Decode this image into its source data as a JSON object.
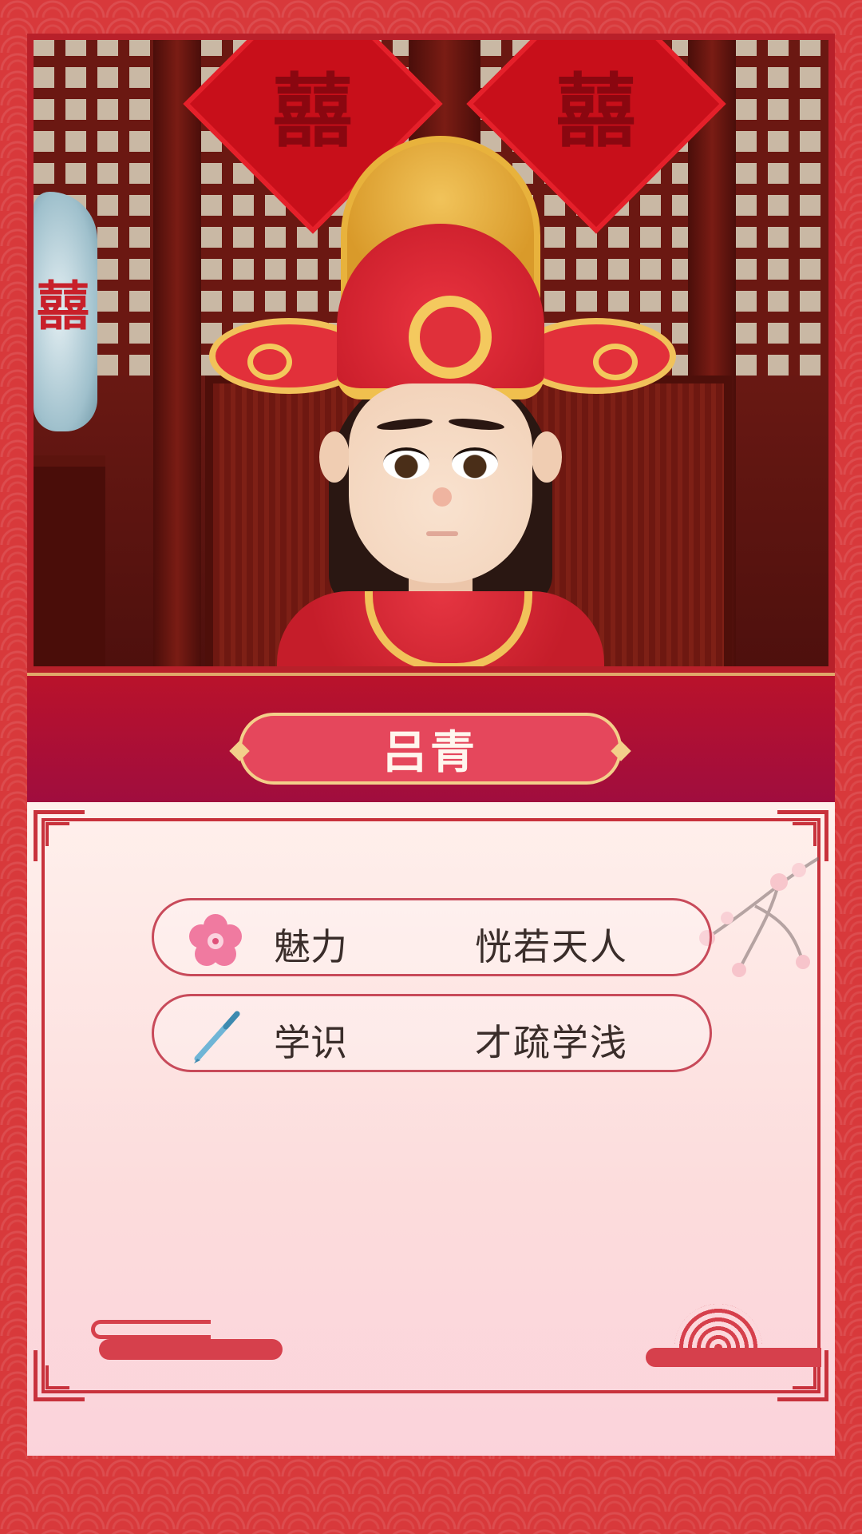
{
  "character": {
    "name": "吕青",
    "decoration_char": "囍"
  },
  "stats": [
    {
      "label": "魅力",
      "value": "恍若天人",
      "icon": "plum-blossom-icon"
    },
    {
      "label": "学识",
      "value": "才疏学浅",
      "icon": "brush-pen-icon"
    }
  ],
  "colors": {
    "background": "#d8393b",
    "band": "#a00d3e",
    "name_plate": "#e5475c",
    "gold": "#f3cf8a",
    "frame": "#c8323c",
    "card": "#fcdcdc"
  }
}
